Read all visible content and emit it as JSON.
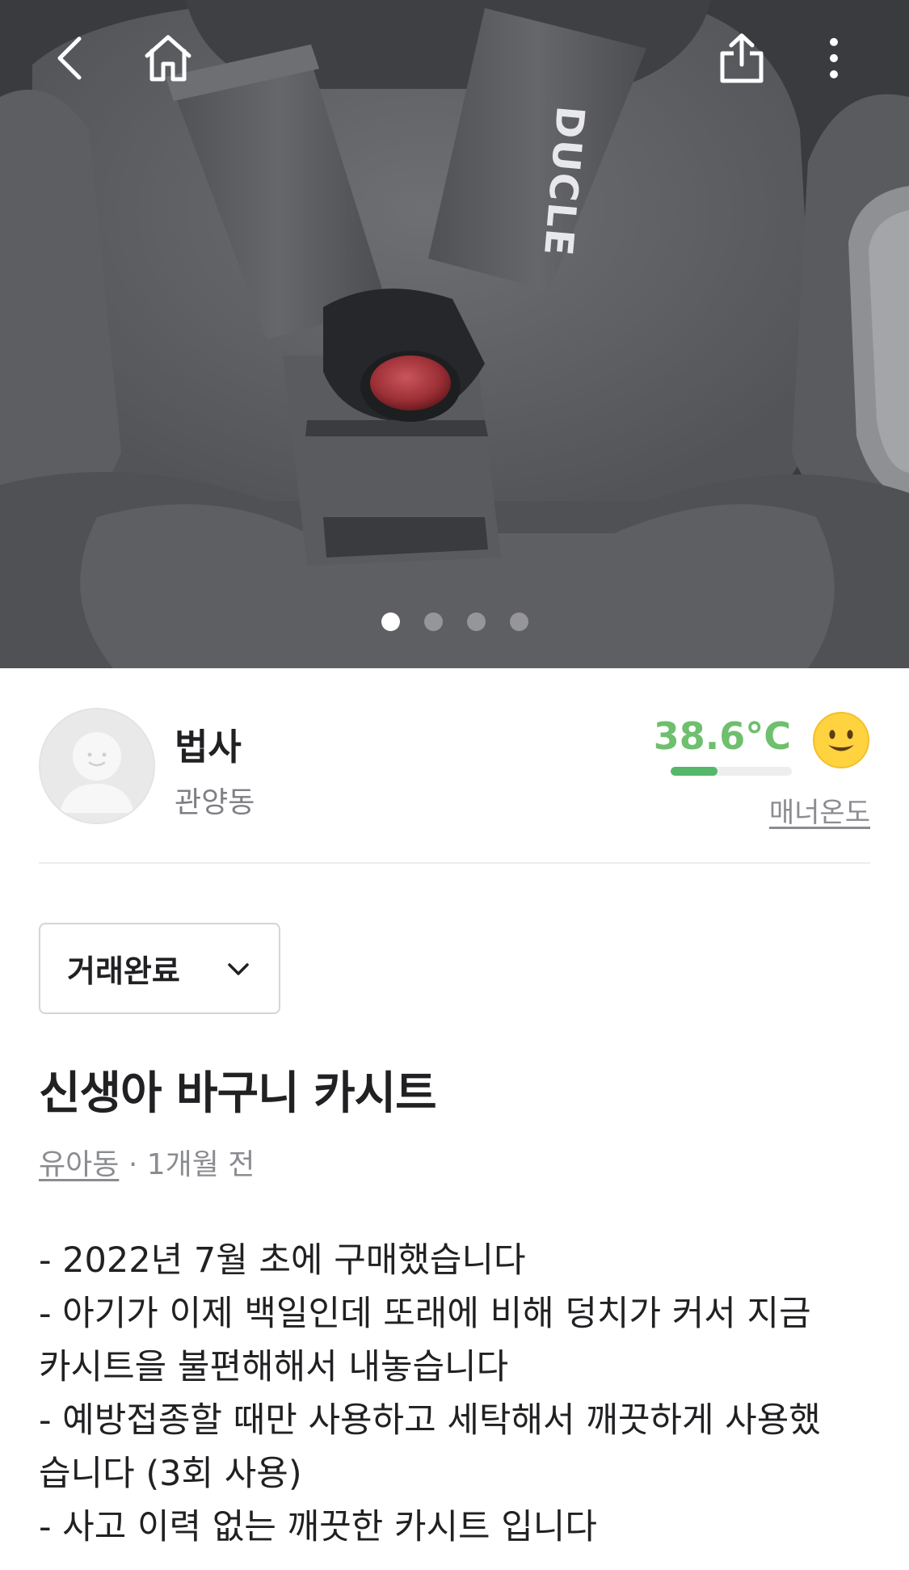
{
  "hero": {
    "brand_text": "DUCLE",
    "carousel": {
      "count": 4,
      "active_index": 0
    },
    "icons": {
      "back": "back-chevron-icon",
      "home": "home-icon",
      "share": "share-icon",
      "more": "more-vertical-icon"
    }
  },
  "seller": {
    "name": "법사",
    "location": "관양동",
    "temperature": "38.6°C",
    "temperature_level": 0.386,
    "manner_label": "매너온도",
    "avatar_icon": "default-avatar-icon",
    "face_icon": "smiley-face-icon"
  },
  "status": {
    "selected": "거래완료",
    "icon": "chevron-down-icon"
  },
  "article": {
    "title": "신생아 바구니 카시트",
    "category": "유아동",
    "separator": " · ",
    "time": "1개월 전",
    "lines": [
      "- 2022년 7월 초에 구매했습니다",
      "- 아기가 이제 백일인데 또래에 비해 덩치가 커서 지금",
      "카시트을 불편해해서 내놓습니다",
      "- 예방접종할 때만 사용하고 세탁해서 깨끗하게 사용했",
      "습니다 (3회 사용)",
      "- 사고 이력 없는 깨끗한 카시트 입니다"
    ]
  },
  "colors": {
    "temperature": "#6ebf6e",
    "temperature_fill": "#55b76a",
    "text_primary": "#212124",
    "text_secondary": "#8b8c91"
  }
}
